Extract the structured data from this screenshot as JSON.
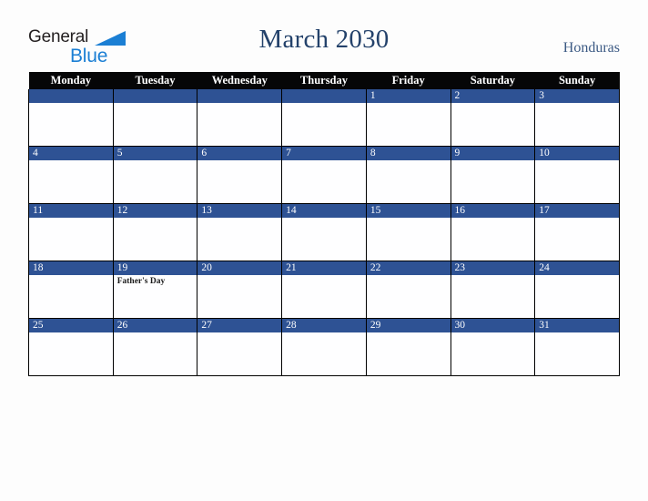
{
  "brand": {
    "name_top": "General",
    "name_bottom": "Blue",
    "color_dark": "#231f20",
    "color_blue": "#1b7fd4"
  },
  "header": {
    "title": "March 2030",
    "country": "Honduras",
    "title_color": "#24426b",
    "country_color": "#3c5a84"
  },
  "calendar": {
    "month": "March",
    "year": "2030",
    "first_day_of_week": "Monday",
    "header_bg": "#060607",
    "daybar_bg": "#2e5294",
    "cell_bg": "#fefeff",
    "weekdays": [
      "Monday",
      "Tuesday",
      "Wednesday",
      "Thursday",
      "Friday",
      "Saturday",
      "Sunday"
    ],
    "weeks": [
      [
        {
          "day": "",
          "events": []
        },
        {
          "day": "",
          "events": []
        },
        {
          "day": "",
          "events": []
        },
        {
          "day": "",
          "events": []
        },
        {
          "day": "1",
          "events": []
        },
        {
          "day": "2",
          "events": []
        },
        {
          "day": "3",
          "events": []
        }
      ],
      [
        {
          "day": "4",
          "events": []
        },
        {
          "day": "5",
          "events": []
        },
        {
          "day": "6",
          "events": []
        },
        {
          "day": "7",
          "events": []
        },
        {
          "day": "8",
          "events": []
        },
        {
          "day": "9",
          "events": []
        },
        {
          "day": "10",
          "events": []
        }
      ],
      [
        {
          "day": "11",
          "events": []
        },
        {
          "day": "12",
          "events": []
        },
        {
          "day": "13",
          "events": []
        },
        {
          "day": "14",
          "events": []
        },
        {
          "day": "15",
          "events": []
        },
        {
          "day": "16",
          "events": []
        },
        {
          "day": "17",
          "events": []
        }
      ],
      [
        {
          "day": "18",
          "events": []
        },
        {
          "day": "19",
          "events": [
            "Father's Day"
          ]
        },
        {
          "day": "20",
          "events": []
        },
        {
          "day": "21",
          "events": []
        },
        {
          "day": "22",
          "events": []
        },
        {
          "day": "23",
          "events": []
        },
        {
          "day": "24",
          "events": []
        }
      ],
      [
        {
          "day": "25",
          "events": []
        },
        {
          "day": "26",
          "events": []
        },
        {
          "day": "27",
          "events": []
        },
        {
          "day": "28",
          "events": []
        },
        {
          "day": "29",
          "events": []
        },
        {
          "day": "30",
          "events": []
        },
        {
          "day": "31",
          "events": []
        }
      ]
    ]
  }
}
